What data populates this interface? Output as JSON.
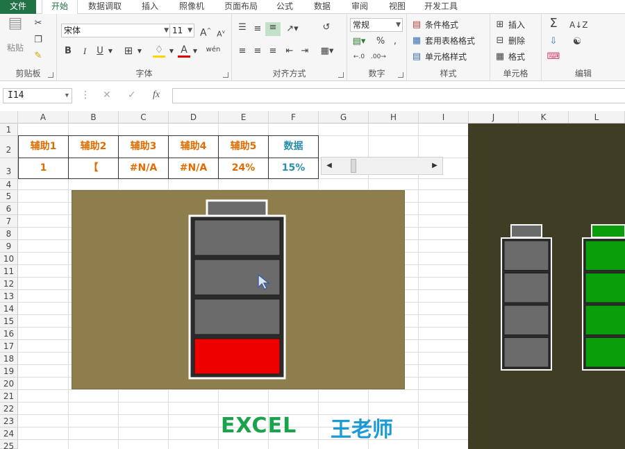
{
  "tabs": [
    "文件",
    "开始",
    "数据调取",
    "插入",
    "照像机",
    "页面布局",
    "公式",
    "数据",
    "审阅",
    "视图",
    "开发工具"
  ],
  "ribbon": {
    "groups": {
      "clipboard": "剪贴板",
      "font": "字体",
      "alignment": "对齐方式",
      "number": "数字",
      "styles": "样式",
      "cells": "单元格",
      "editing": "编辑"
    },
    "paste_label": "粘贴",
    "font_name": "宋体",
    "font_size": "11",
    "number_format": "常规",
    "styles_items": [
      "条件格式",
      "套用表格格式",
      "单元格样式"
    ],
    "cells_items": [
      "插入",
      "删除",
      "格式"
    ],
    "bold": "B",
    "italic": "I",
    "underline": "U",
    "percent": "%"
  },
  "formula_bar": {
    "name_box": "I14",
    "fx": "fx",
    "formula": ""
  },
  "columns": [
    "A",
    "B",
    "C",
    "D",
    "E",
    "F",
    "G",
    "H",
    "I",
    "J",
    "K",
    "L"
  ],
  "rows": [
    "1",
    "2",
    "3",
    "4",
    "5",
    "6",
    "7",
    "8",
    "9",
    "10",
    "11",
    "12",
    "13",
    "14",
    "15",
    "16",
    "17",
    "18",
    "19",
    "20",
    "21",
    "22",
    "23",
    "24",
    "25"
  ],
  "table": {
    "headers": [
      "辅助1",
      "辅助2",
      "辅助3",
      "辅助4",
      "辅助5",
      "数据"
    ],
    "values": [
      "1",
      "【",
      "#N/A",
      "#N/A",
      "24%",
      "15%"
    ]
  },
  "scrollbar": {
    "value_percent": 15
  },
  "battery_main": {
    "fill_segments": 1,
    "total_segments": 4,
    "fill_color": "#ee0000",
    "empty_color": "#6b6b6b"
  },
  "battery_right_1": {
    "fill_segments": 0,
    "total_segments": 4,
    "empty_color": "#6b6b6b"
  },
  "battery_right_2": {
    "fill_segments": 4,
    "total_segments": 4,
    "fill_color": "#0a9e0a"
  },
  "brand": {
    "left": "EXCEL",
    "right": "王老师"
  },
  "colors": {
    "accent": "#217346",
    "orange": "#e06c00",
    "teal": "#2a8fa8",
    "chart_bg": "#8e7e4e",
    "dark_bg": "#3f3d24"
  }
}
